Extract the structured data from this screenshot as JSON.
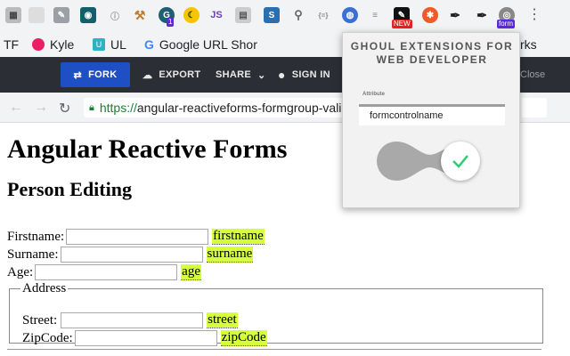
{
  "extensions": {
    "badge_new": "NEW",
    "badge_form": "form",
    "badge_count": "1",
    "js_label": "JS"
  },
  "bookmarks": [
    {
      "label": "TF"
    },
    {
      "label": "Kyle"
    },
    {
      "label": "UL"
    },
    {
      "label": "Google URL Shor"
    },
    {
      "label": "rks"
    }
  ],
  "stackblitz": {
    "fork": "FORK",
    "export": "EXPORT",
    "share": "SHARE",
    "signin": "SIGN IN",
    "close": "Close"
  },
  "address": {
    "url_scheme": "https://",
    "url_rest": "angular-reactiveforms-formgroup-vali"
  },
  "page": {
    "title": "Angular Reactive Forms",
    "subtitle": "Person Editing",
    "fields": [
      {
        "label": "Firstname:",
        "tag": "firstname"
      },
      {
        "label": "Surname:",
        "tag": "surname"
      },
      {
        "label": "Age:",
        "tag": "age"
      }
    ],
    "address_legend": "Address",
    "address_fields": [
      {
        "label": "Street:",
        "tag": "street"
      },
      {
        "label": "ZipCode:",
        "tag": "zipCode"
      }
    ]
  },
  "popup": {
    "title": "GHOUL EXTENSIONS FOR WEB DEVELOPER",
    "attribute_label": "Attribute",
    "attribute_value": "formcontrolname",
    "toggle_on": true
  },
  "colors": {
    "highlight": "#d6ff3c",
    "fork_button": "#1f4fc4",
    "toolbar_dark": "#2b2f35",
    "secure_green": "#188038",
    "check_green": "#2ecc71"
  }
}
